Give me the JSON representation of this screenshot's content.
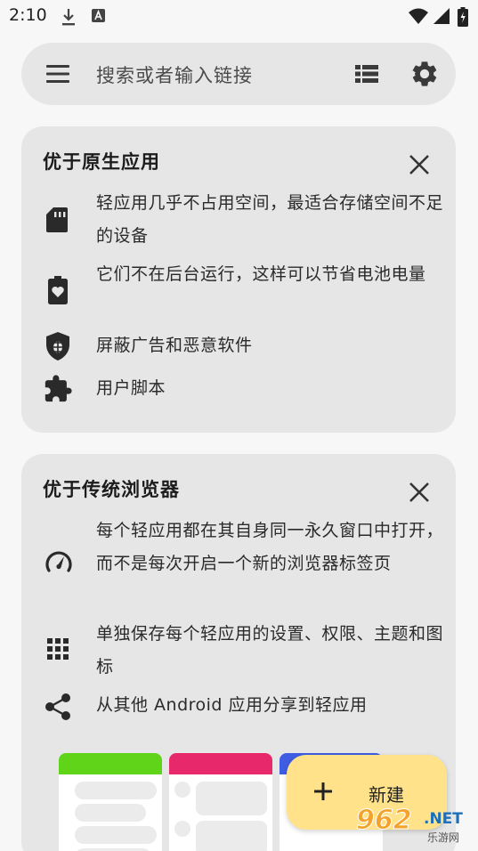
{
  "status_bar": {
    "time": "2:10"
  },
  "search": {
    "placeholder": "搜索或者输入链接"
  },
  "card1": {
    "title": "优于原生应用",
    "features": [
      {
        "icon": "sd-card-icon",
        "text": "轻应用几乎不占用空间，最适合存储空间不足的设备"
      },
      {
        "icon": "battery-heart-icon",
        "text": "它们不在后台运行，这样可以节省电池电量"
      },
      {
        "icon": "shield-bug-icon",
        "text": "屏蔽广告和恶意软件"
      },
      {
        "icon": "puzzle-icon",
        "text": "用户脚本"
      }
    ]
  },
  "card2": {
    "title": "优于传统浏览器",
    "features": [
      {
        "icon": "speedometer-icon",
        "text": "每个轻应用都在其自身同一永久窗口中打开，而不是每次开启一个新的浏览器标签页"
      },
      {
        "icon": "apps-grid-icon",
        "text": "单独保存每个轻应用的设置、权限、主题和图标"
      },
      {
        "icon": "share-icon",
        "text": "从其他 Android 应用分享到轻应用"
      }
    ]
  },
  "colors": {
    "illus_green": "#5fd418",
    "illus_pink": "#e7286a",
    "illus_blue": "#3f5de3",
    "fab_bg": "#ffe28a"
  },
  "fab": {
    "label": "新建"
  },
  "watermark": {
    "brand": "962",
    "domain": ".NET",
    "sub": "乐游网"
  }
}
